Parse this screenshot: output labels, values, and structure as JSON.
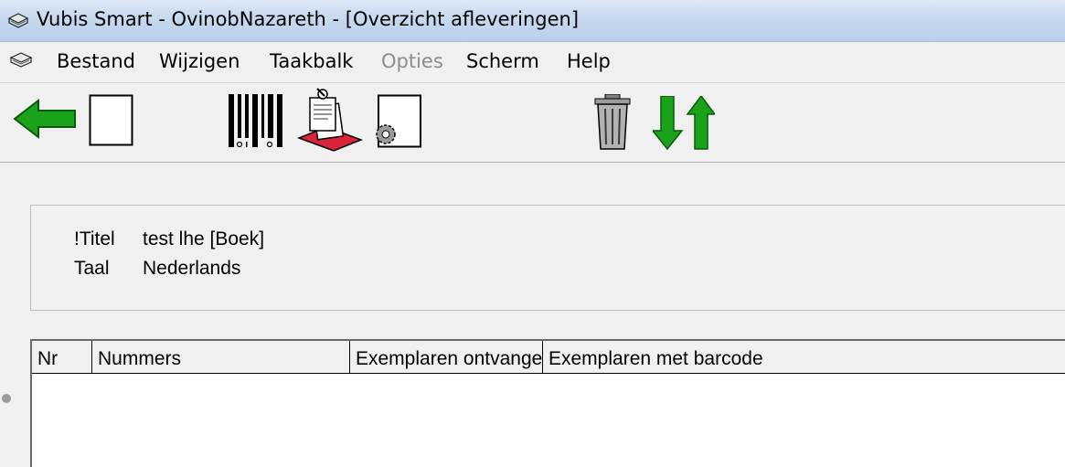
{
  "window": {
    "title": "Vubis Smart - OvinobNazareth - [Overzicht afleveringen]",
    "app_icon": "vubis-book-icon"
  },
  "menubar": {
    "icon": "vubis-book-icon",
    "items": [
      {
        "label": "Bestand",
        "enabled": true
      },
      {
        "label": "Wijzigen",
        "enabled": true
      },
      {
        "label": "Taakbalk",
        "enabled": true
      },
      {
        "label": "Opties",
        "enabled": false
      },
      {
        "label": "Scherm",
        "enabled": true
      },
      {
        "label": "Help",
        "enabled": true
      }
    ]
  },
  "toolbar": {
    "buttons": [
      {
        "icon": "back-arrow-icon"
      },
      {
        "icon": "new-document-icon"
      },
      {
        "icon": "barcode-icon"
      },
      {
        "icon": "receive-issue-icon"
      },
      {
        "icon": "document-settings-icon"
      },
      {
        "icon": "trash-icon"
      },
      {
        "icon": "sort-up-down-icon"
      }
    ]
  },
  "record": {
    "fields": [
      {
        "label": "!Titel",
        "value": "test lhe [Boek]"
      },
      {
        "label": "Taal",
        "value": "Nederlands"
      }
    ]
  },
  "grid": {
    "columns": [
      "Nr",
      "Nummers",
      "Exemplaren ontvangen",
      "Exemplaren met barcode"
    ],
    "rows": []
  },
  "colors": {
    "title_gradient_top": "#dbe7f6",
    "title_gradient_bottom": "#b9cfea",
    "arrow_green": "#1aa31a",
    "window_bg": "#f0f0f0"
  }
}
